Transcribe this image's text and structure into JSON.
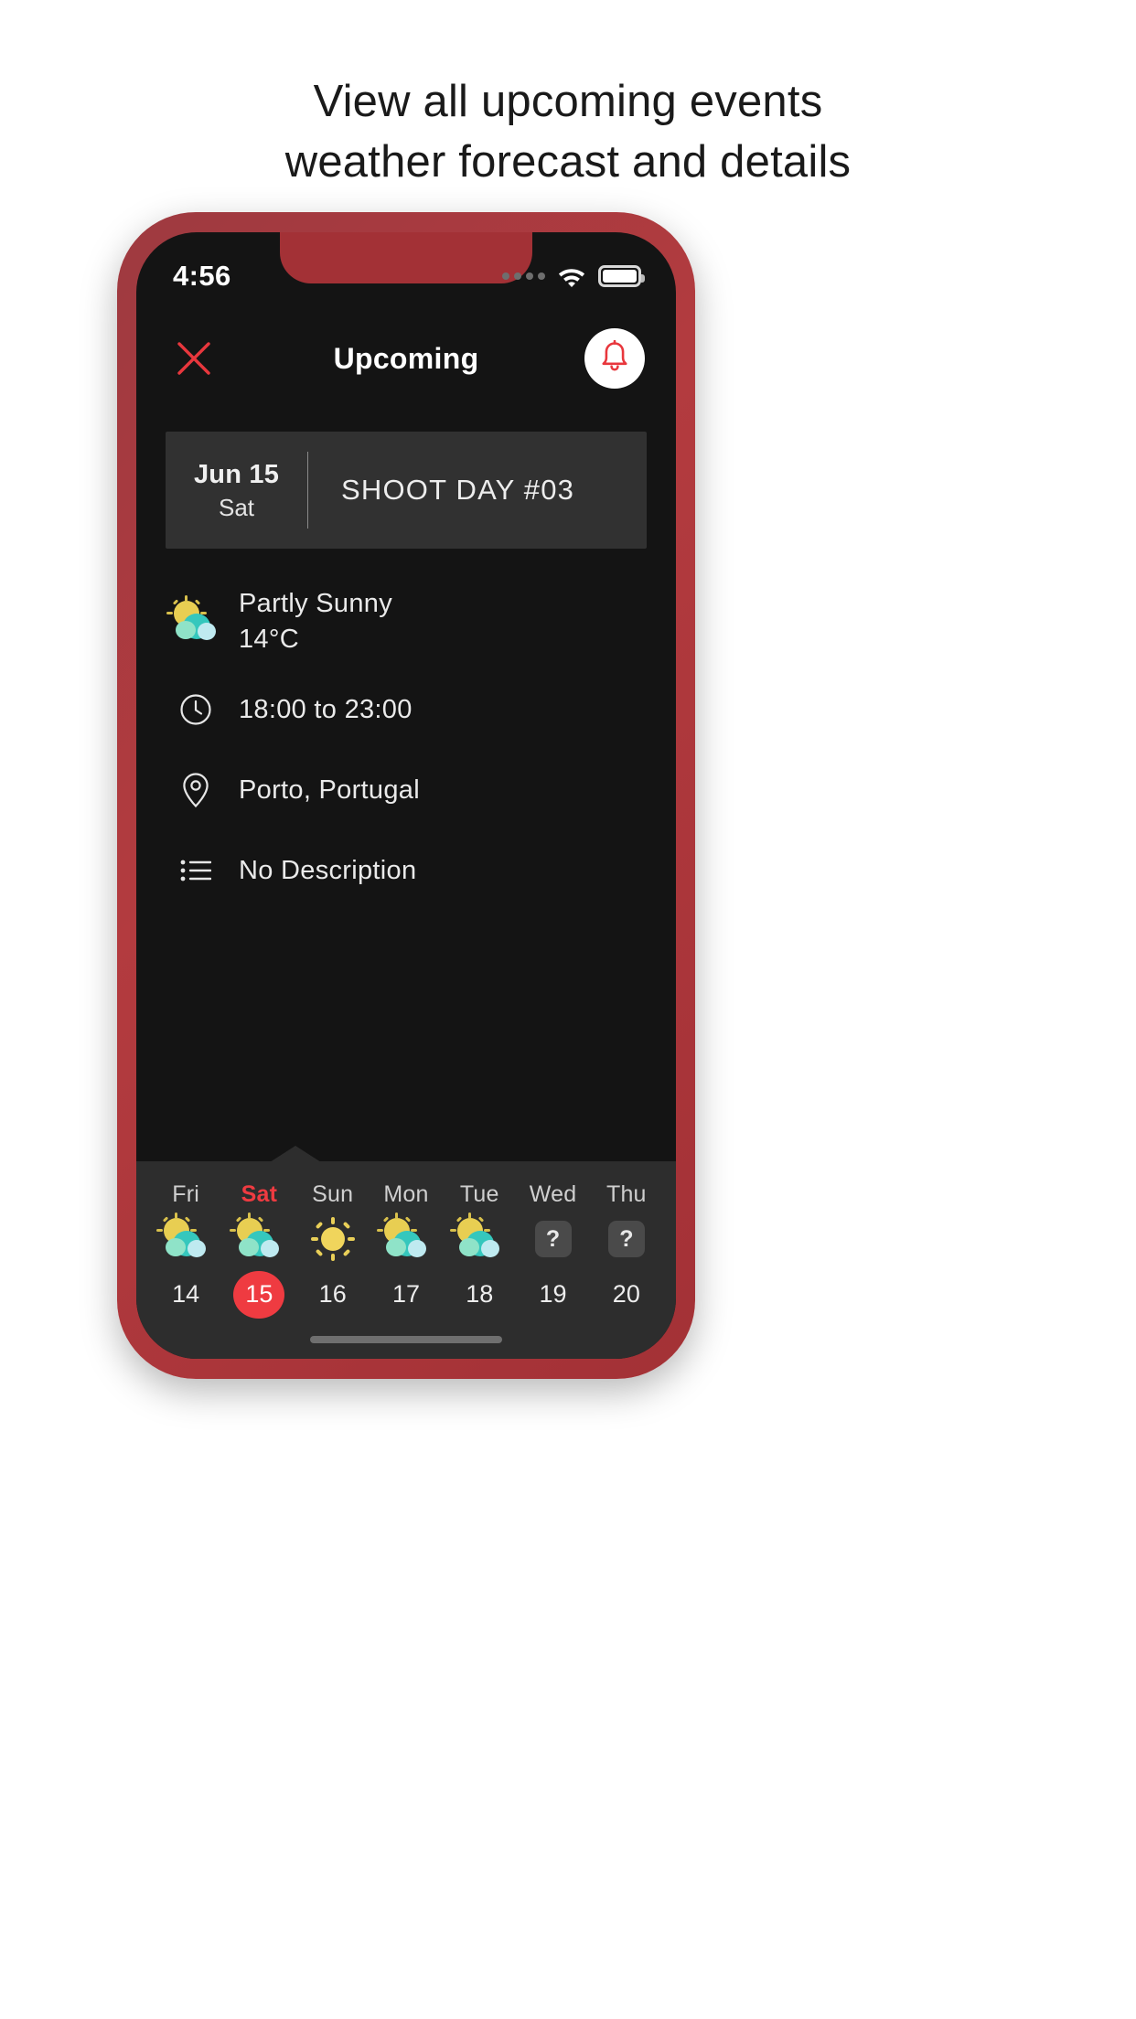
{
  "headline": {
    "line1": "View all upcoming events",
    "line2": "weather forecast and details"
  },
  "colors": {
    "accent_red": "#ef3b41",
    "frame_red": "#a33136",
    "screen_bg": "#141414",
    "card_bg": "#313131",
    "strip_bg": "#2d2d2d"
  },
  "status_bar": {
    "time": "4:56",
    "signal_icon": "signal-dots-icon",
    "wifi_icon": "wifi-icon",
    "battery_icon": "battery-icon"
  },
  "header": {
    "close_icon": "close-icon",
    "title": "Upcoming",
    "bell_icon": "bell-icon"
  },
  "event_card": {
    "date": "Jun 15",
    "weekday": "Sat",
    "title": "SHOOT DAY #03"
  },
  "details": [
    {
      "icon": "partly-sunny-icon",
      "label": "Partly Sunny",
      "sub": "14°C"
    },
    {
      "icon": "clock-icon",
      "label": "18:00 to 23:00",
      "sub": ""
    },
    {
      "icon": "location-pin-icon",
      "label": "Porto, Portugal",
      "sub": ""
    },
    {
      "icon": "list-icon",
      "label": "No Description",
      "sub": ""
    }
  ],
  "day_strip": {
    "days": [
      {
        "name": "Fri",
        "num": "14",
        "weather": "partly-sunny-icon",
        "selected": false
      },
      {
        "name": "Sat",
        "num": "15",
        "weather": "partly-sunny-icon",
        "selected": true
      },
      {
        "name": "Sun",
        "num": "16",
        "weather": "sunny-icon",
        "selected": false
      },
      {
        "name": "Mon",
        "num": "17",
        "weather": "partly-sunny-icon",
        "selected": false
      },
      {
        "name": "Tue",
        "num": "18",
        "weather": "partly-sunny-icon",
        "selected": false
      },
      {
        "name": "Wed",
        "num": "19",
        "weather": "unknown-icon",
        "selected": false
      },
      {
        "name": "Thu",
        "num": "20",
        "weather": "unknown-icon",
        "selected": false
      }
    ],
    "unknown_glyph": "?"
  },
  "home_indicator": "home-indicator"
}
